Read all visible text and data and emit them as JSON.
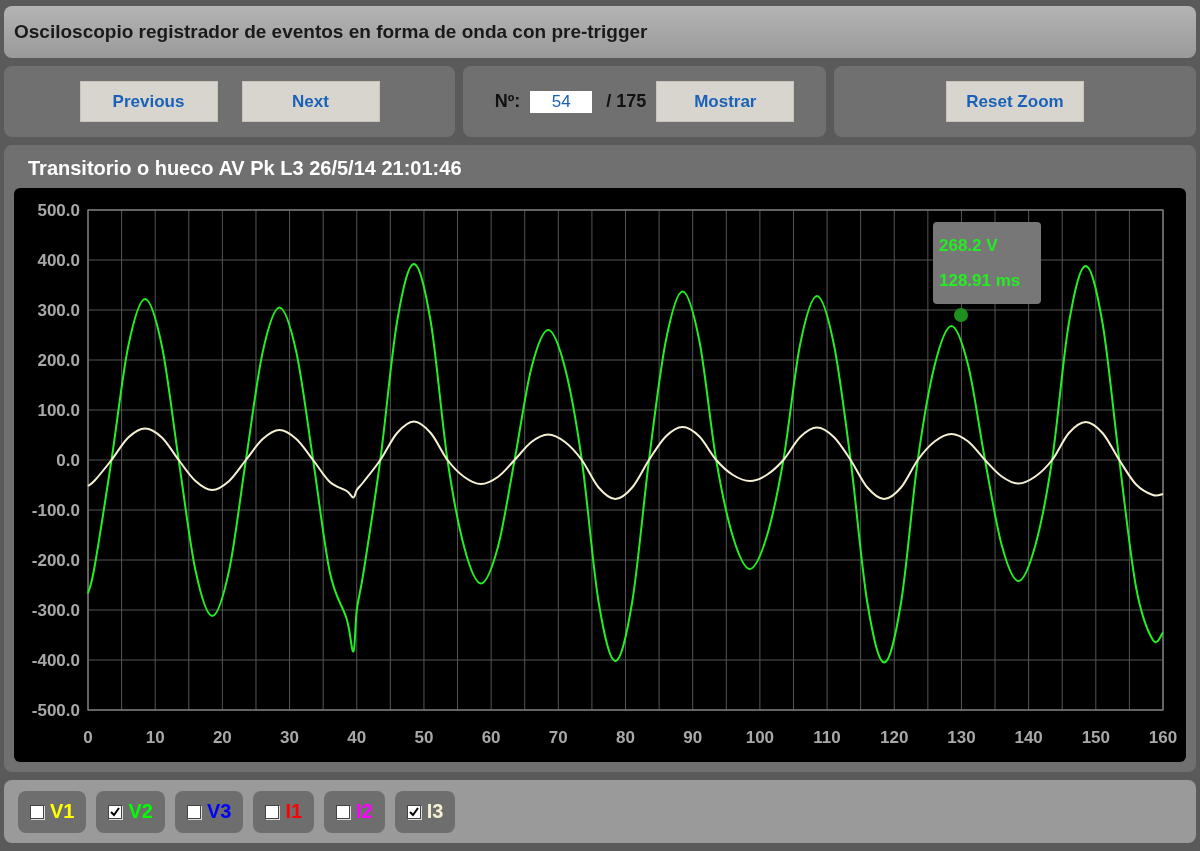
{
  "window": {
    "title": "Osciloscopio registrador de eventos en forma de onda con pre-trigger"
  },
  "navigation": {
    "buttons": [
      "Previous",
      "Next"
    ]
  },
  "event_selector": {
    "label": "Nº:",
    "value": "54",
    "total": "/ 175",
    "button": "Mostrar"
  },
  "zoom": {
    "button": "Reset Zoom"
  },
  "chart_panel": {
    "title": "Transitorio o hueco AV Pk L3 26/5/14 21:01:46",
    "tooltip": {
      "lines": [
        "268.2 V",
        "128.91 ms"
      ]
    },
    "chart_data": {
      "type": "line",
      "x": [
        0,
        1,
        3.5,
        6,
        8.5,
        11,
        13.5,
        16,
        18.5,
        21,
        23.5,
        26,
        28.5,
        31,
        33.5,
        36,
        38.5,
        39.5,
        40,
        41,
        43.5,
        46,
        48.5,
        51,
        53.5,
        56,
        58.5,
        61,
        63.5,
        66,
        68.5,
        71,
        73.5,
        76,
        78.5,
        81,
        83.5,
        86,
        88.5,
        91,
        93.5,
        96,
        98.5,
        101,
        103.5,
        106,
        108.5,
        111,
        113.5,
        116,
        118.5,
        121,
        123.5,
        126,
        128.5,
        131,
        133.5,
        136,
        138.5,
        141,
        143.5,
        146,
        148.5,
        151,
        153.5,
        156,
        158.5,
        160
      ],
      "series": [
        {
          "color": "#22ee22",
          "values": [
            -267,
            -212,
            0,
            228,
            322,
            228,
            0,
            -221,
            -312,
            -221,
            0,
            216,
            305,
            216,
            0,
            -225,
            -318,
            -383,
            -300,
            -225,
            0,
            277,
            392,
            277,
            0,
            -175,
            -247,
            -175,
            0,
            184,
            260,
            184,
            0,
            -284,
            -402,
            -284,
            0,
            238,
            337,
            238,
            0,
            -154,
            -218,
            -154,
            0,
            232,
            328,
            232,
            0,
            -286,
            -405,
            -286,
            0,
            189,
            268,
            189,
            0,
            -171,
            -242,
            -171,
            0,
            274,
            388,
            274,
            0,
            -255,
            -360,
            -345
          ]
        },
        {
          "color": "#f5f0d2",
          "values": [
            -52,
            -41,
            0,
            45,
            63,
            45,
            0,
            -42,
            -60,
            -42,
            0,
            42,
            60,
            42,
            0,
            -44,
            -62,
            -75,
            -60,
            -44,
            0,
            54,
            77,
            54,
            0,
            -34,
            -48,
            -34,
            0,
            36,
            51,
            36,
            0,
            -55,
            -78,
            -55,
            0,
            47,
            66,
            47,
            0,
            -30,
            -42,
            -30,
            0,
            46,
            65,
            46,
            0,
            -55,
            -78,
            -55,
            0,
            37,
            52,
            37,
            0,
            -33,
            -47,
            -33,
            0,
            54,
            76,
            54,
            0,
            -49,
            -70,
            -68
          ]
        }
      ],
      "xlim": [
        0,
        160
      ],
      "ylim": [
        -500,
        500
      ],
      "xticks": [
        0,
        10,
        20,
        30,
        40,
        50,
        60,
        70,
        80,
        90,
        100,
        110,
        120,
        130,
        140,
        150,
        160
      ],
      "yticks": [
        {
          "value": 500,
          "label": "500.0"
        },
        {
          "value": 400,
          "label": "400.0"
        },
        {
          "value": 300,
          "label": "300.0"
        },
        {
          "value": 200,
          "label": "200.0"
        },
        {
          "value": 100,
          "label": "100.0"
        },
        {
          "value": 0,
          "label": "0.0"
        },
        {
          "value": -100,
          "label": "-100.0"
        },
        {
          "value": -200,
          "label": "-200.0"
        },
        {
          "value": -300,
          "label": "-300.0"
        },
        {
          "value": -400,
          "label": "-400.0"
        },
        {
          "value": -500,
          "label": "-500.0"
        }
      ],
      "grid": true
    }
  },
  "channels": [
    {
      "label": "V1",
      "checked": false,
      "color": "#ffff00"
    },
    {
      "label": "V2",
      "checked": true,
      "color": "#00ff00"
    },
    {
      "label": "V3",
      "checked": false,
      "color": "#0000ff"
    },
    {
      "label": "I1",
      "checked": false,
      "color": "#ff0000"
    },
    {
      "label": "I2",
      "checked": false,
      "color": "#ff00ff"
    },
    {
      "label": "I3",
      "checked": true,
      "color": "#f5f0d2"
    }
  ]
}
